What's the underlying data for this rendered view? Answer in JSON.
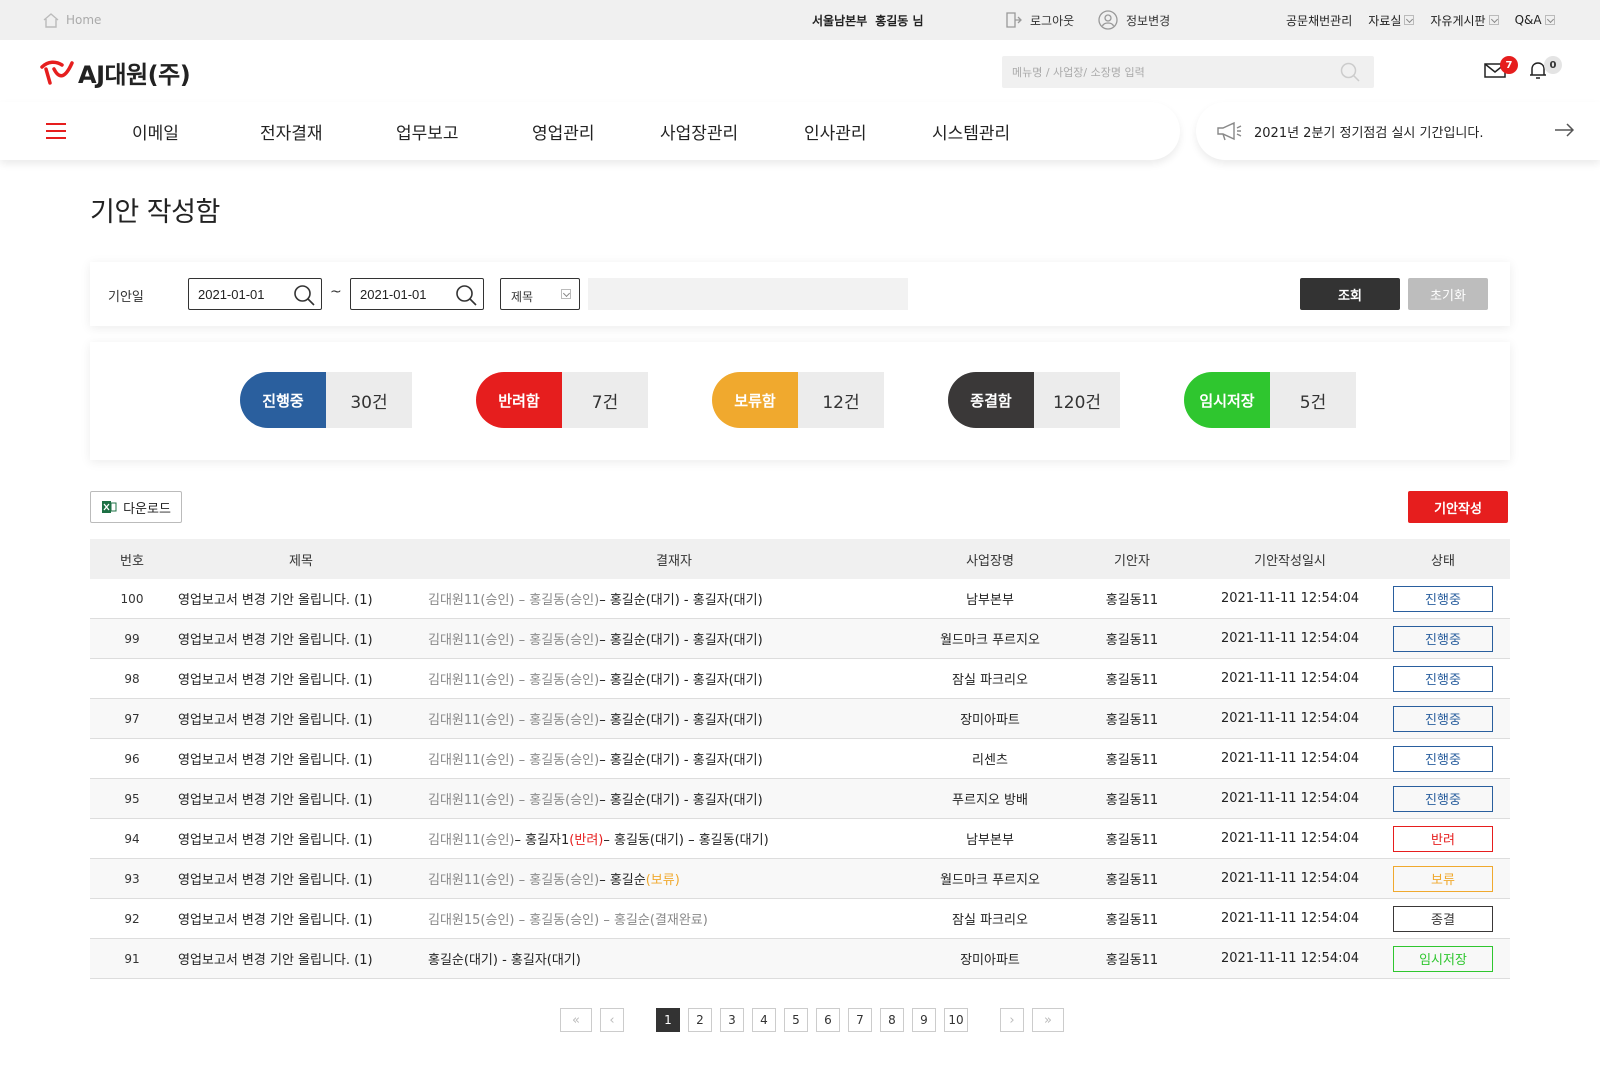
{
  "utility": {
    "home_label": "Home",
    "user_org": "서울남본부",
    "user_name": "홍길동 님",
    "logout_label": "로그아웃",
    "profile_label": "정보변경",
    "links": [
      "공문채번관리",
      "자료실",
      "자유게시판",
      "Q&A"
    ]
  },
  "brand": {
    "name": "AJ대원(주)"
  },
  "search": {
    "placeholder": "메뉴명 / 사업장/ 소장명 입력"
  },
  "alerts": {
    "mail_count": "7",
    "bell_count": "0"
  },
  "nav": {
    "items": [
      "이메일",
      "전자결재",
      "업무보고",
      "영업관리",
      "사업장관리",
      "인사관리",
      "시스템관리"
    ]
  },
  "notice": {
    "text": "2021년 2분기 정기점검 실시 기간입니다."
  },
  "page": {
    "title": "기안 작성함"
  },
  "filter": {
    "date_label": "기안일",
    "date_from": "2021-01-01",
    "date_to": "2021-01-01",
    "separator": "~",
    "field_select": "제목",
    "keyword": "",
    "search_label": "조회",
    "reset_label": "초기화"
  },
  "summary": [
    {
      "label": "진행중",
      "count": "30건",
      "color": "#2a5f9e"
    },
    {
      "label": "반려함",
      "count": "7건",
      "color": "#e61e1e"
    },
    {
      "label": "보류함",
      "count": "12건",
      "color": "#f0a92e"
    },
    {
      "label": "종결함",
      "count": "120건",
      "color": "#3a3838"
    },
    {
      "label": "임시저장",
      "count": "5건",
      "color": "#2fc62f"
    }
  ],
  "actions": {
    "download_label": "다운로드",
    "write_label": "기안작성"
  },
  "table": {
    "headers": [
      "번호",
      "제목",
      "결재자",
      "사업장명",
      "기안자",
      "기안작성일시",
      "상태"
    ],
    "rows": [
      {
        "no": "100",
        "title": "영업보고서 변경 기안 올립니다. (1)",
        "pre": "김대원11(승인) – 홍길동(승인)",
        "tag": "",
        "tag_color": "",
        "post": " – 홍길순(대기) - 홍길자(대기)",
        "site": "남부본부",
        "drafter": "홍길동11",
        "date": "2021-11-11 12:54:04",
        "status": "진행중",
        "status_color": "#2a5f9e"
      },
      {
        "no": "99",
        "title": "영업보고서 변경 기안 올립니다. (1)",
        "pre": "김대원11(승인) – 홍길동(승인)",
        "tag": "",
        "tag_color": "",
        "post": " – 홍길순(대기) - 홍길자(대기)",
        "site": "월드마크 푸르지오",
        "drafter": "홍길동11",
        "date": "2021-11-11 12:54:04",
        "status": "진행중",
        "status_color": "#2a5f9e"
      },
      {
        "no": "98",
        "title": "영업보고서 변경 기안 올립니다. (1)",
        "pre": "김대원11(승인) – 홍길동(승인)",
        "tag": "",
        "tag_color": "",
        "post": " – 홍길순(대기) - 홍길자(대기)",
        "site": "잠실 파크리오",
        "drafter": "홍길동11",
        "date": "2021-11-11 12:54:04",
        "status": "진행중",
        "status_color": "#2a5f9e"
      },
      {
        "no": "97",
        "title": "영업보고서 변경 기안 올립니다. (1)",
        "pre": "김대원11(승인) – 홍길동(승인)",
        "tag": "",
        "tag_color": "",
        "post": " – 홍길순(대기) - 홍길자(대기)",
        "site": "장미아파트",
        "drafter": "홍길동11",
        "date": "2021-11-11 12:54:04",
        "status": "진행중",
        "status_color": "#2a5f9e"
      },
      {
        "no": "96",
        "title": "영업보고서 변경 기안 올립니다. (1)",
        "pre": "김대원11(승인) – 홍길동(승인)",
        "tag": "",
        "tag_color": "",
        "post": " – 홍길순(대기) - 홍길자(대기)",
        "site": "리센츠",
        "drafter": "홍길동11",
        "date": "2021-11-11 12:54:04",
        "status": "진행중",
        "status_color": "#2a5f9e"
      },
      {
        "no": "95",
        "title": "영업보고서 변경 기안 올립니다. (1)",
        "pre": "김대원11(승인) – 홍길동(승인)",
        "tag": "",
        "tag_color": "",
        "post": " – 홍길순(대기) - 홍길자(대기)",
        "site": "푸르지오 방배",
        "drafter": "홍길동11",
        "date": "2021-11-11 12:54:04",
        "status": "진행중",
        "status_color": "#2a5f9e"
      },
      {
        "no": "94",
        "title": "영업보고서 변경 기안 올립니다. (1)",
        "pre": "김대원11(승인)",
        "tag": " – 홍길자1(반려)",
        "tag_color": "#e61e1e",
        "post": " – 홍길동(대기) – 홍길동(대기)",
        "site": "남부본부",
        "drafter": "홍길동11",
        "date": "2021-11-11 12:54:04",
        "status": "반려",
        "status_color": "#e61e1e"
      },
      {
        "no": "93",
        "title": "영업보고서 변경 기안 올립니다. (1)",
        "pre": "김대원11(승인) – 홍길동(승인)",
        "tag": " – 홍길순(보류)",
        "tag_color": "#f0a92e",
        "post": "",
        "site": "월드마크 푸르지오",
        "drafter": "홍길동11",
        "date": "2021-11-11 12:54:04",
        "status": "보류",
        "status_color": "#f0a92e"
      },
      {
        "no": "92",
        "title": "영업보고서 변경 기안 올립니다. (1)",
        "pre": "김대원15(승인) – 홍길동(승인) – 홍길순(결재완료)",
        "tag": "",
        "tag_color": "",
        "post": "",
        "site": "잠실 파크리오",
        "drafter": "홍길동11",
        "date": "2021-11-11 12:54:04",
        "status": "종결",
        "status_color": "#3a3838"
      },
      {
        "no": "91",
        "title": "영업보고서 변경 기안 올립니다. (1)",
        "pre": "",
        "tag": "",
        "tag_color": "",
        "post": "홍길순(대기) - 홍길자(대기)",
        "site": "장미아파트",
        "drafter": "홍길동11",
        "date": "2021-11-11 12:54:04",
        "status": "임시저장",
        "status_color": "#2fc62f"
      }
    ]
  },
  "pagination": {
    "first": "«",
    "prev": "‹",
    "pages": [
      "1",
      "2",
      "3",
      "4",
      "5",
      "6",
      "7",
      "8",
      "9",
      "10"
    ],
    "current": "1",
    "next": "›",
    "last": "»"
  },
  "colors": {
    "brand": "#e61e1e",
    "dark": "#333333"
  },
  "icons": {
    "home": "home-icon",
    "logout": "logout-icon",
    "profile": "user-icon",
    "search": "search-icon",
    "mail": "mail-icon",
    "bell": "bell-icon",
    "menu": "hamburger-icon",
    "notice": "megaphone-icon",
    "arrow": "arrow-right-icon",
    "calendar_search": "search-icon",
    "excel": "excel-icon"
  }
}
